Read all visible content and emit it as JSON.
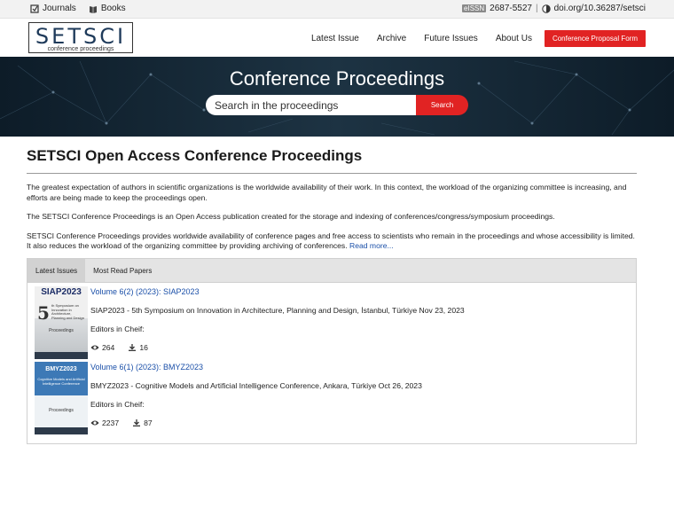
{
  "topbar": {
    "journals_label": "Journals",
    "books_label": "Books",
    "eissn_badge": "eISSN",
    "eissn_value": "2687-5527",
    "doi": "doi.org/10.36287/setsci"
  },
  "header": {
    "logo_text": "SETSCI",
    "logo_subtitle": "conference proceedings",
    "nav": [
      "Latest Issue",
      "Archive",
      "Future Issues",
      "About Us"
    ],
    "cta_label": "Conference Proposal Form"
  },
  "hero": {
    "title": "Conference Proceedings",
    "search_placeholder": "Search in the proceedings",
    "search_button": "Search"
  },
  "main": {
    "title": "SETSCI Open Access Conference Proceedings",
    "paragraphs": [
      "The greatest expectation of authors in scientific organizations is the worldwide availability of their work. In this context, the workload of the organizing committee is increasing, and efforts are being made to keep the proceedings open.",
      "The SETSCI Conference Proceedings is an Open Access publication created for the storage and indexing of conferences/congress/symposium proceedings.",
      "SETSCI Conference Proceedings provides worldwide availability of conference pages and free access to scientists who remain in the proceedings and whose accessibility is limited. It also reduces the workload of the organizing committee by providing archiving of conferences."
    ],
    "read_more": "Read more..."
  },
  "panel": {
    "tabs": [
      "Latest Issues",
      "Most Read Papers"
    ],
    "issues": [
      {
        "volume": "Volume 6(2) (2023): SIAP2023",
        "conference": "SIAP2023 - 5th Symposium on Innovation in Architecture, Planning and Design, İstanbul, Türkiye Nov 23, 2023",
        "editors": "Editors in Cheif:",
        "views": "264",
        "downloads": "16",
        "cover_title": "SIAP2023",
        "cover_number": "5",
        "cover_subtitle": "th Symposium on Innovation in Architecture, Planning and Design",
        "cover_label": "Proceedings"
      },
      {
        "volume": "Volume 6(1) (2023): BMYZ2023",
        "conference": "BMYZ2023 - Cognitive Models and Artificial Intelligence Conference, Ankara, Türkiye Oct 26, 2023",
        "editors": "Editors in Cheif:",
        "views": "2237",
        "downloads": "87",
        "cover_title": "BMYZ2023",
        "cover_subtitle": "Cognitive Models and Artificial Intelligence Conference",
        "cover_label": "Proceedings"
      }
    ]
  },
  "colors": {
    "accent": "#e12323",
    "link": "#1a4fa8",
    "hero_bg": "#0d1c28"
  }
}
